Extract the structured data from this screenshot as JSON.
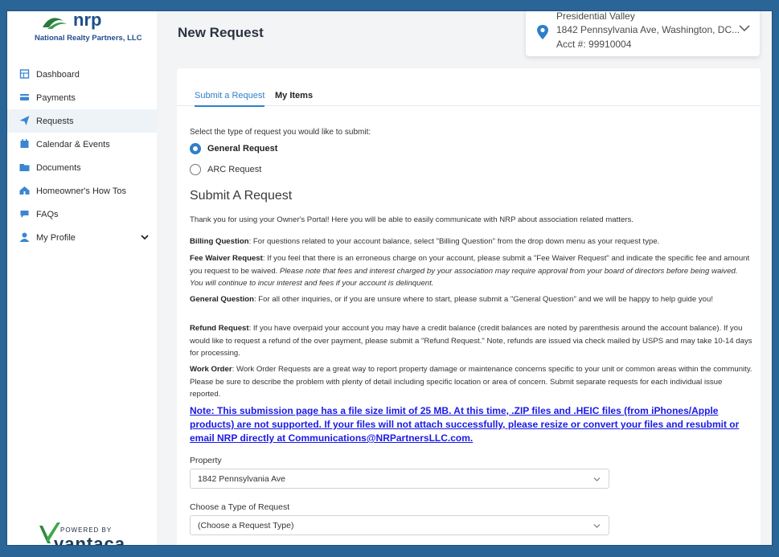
{
  "sidebar": {
    "logo_text": "nrp",
    "company": "National Realty Partners, LLC",
    "items": [
      {
        "label": "Dashboard",
        "icon": "dashboard-icon"
      },
      {
        "label": "Payments",
        "icon": "card-icon"
      },
      {
        "label": "Requests",
        "icon": "send-icon"
      },
      {
        "label": "Calendar & Events",
        "icon": "calendar-icon"
      },
      {
        "label": "Documents",
        "icon": "folder-icon"
      },
      {
        "label": "Homeowner's How Tos",
        "icon": "home-info-icon"
      },
      {
        "label": "FAQs",
        "icon": "faq-icon"
      },
      {
        "label": "My Profile",
        "icon": "user-icon"
      }
    ],
    "powered_by": "POWERED BY",
    "powered_brand": "vantaca"
  },
  "header": {
    "title": "New Request",
    "account": {
      "community": "Presidential Valley",
      "address": "1842 Pennsylvania Ave, Washington, DC...",
      "acct": "Acct #: 99910004"
    }
  },
  "tabs": [
    {
      "label": "Submit a Request",
      "active": true
    },
    {
      "label": "My Items",
      "active": false
    }
  ],
  "form": {
    "select_prompt": "Select the type of request you would like to submit:",
    "radio_general": "General Request",
    "radio_arc": "ARC Request",
    "heading": "Submit A Request",
    "intro": "Thank you for using your Owner's Portal!  Here you will be able to easily communicate with NRP about association related matters.",
    "billing_label": "Billing Question",
    "billing_text": ":  For questions related to your account balance, select \"Billing Question\" from the drop down menu as your request type.",
    "fee_label": "Fee Waiver Request",
    "fee_text": ": If you feel that there is an erroneous charge on  your account, please submit a \"Fee Waiver Request\" and indicate the specific fee and amount you request to be waived.  ",
    "fee_italic": "Please note that fees and interest charged by your association may require approval from your board of directors before being waived.  You will continue to incur interest and fees if your account is delinquent.",
    "general_label": "General Question",
    "general_text": ":  For all other inquiries, or if you are unsure where to start, please submit a \"General Question\" and we will be happy to help guide you!",
    "refund_label": "Refund Request",
    "refund_text": ":  If you have overpaid your account you may have a credit balance (credit balances are noted by parenthesis around the account balance).  If you would like to request a refund of the over payment, please submit a \"Refund Request.\"  Note, refunds are issued via check mailed by USPS and may take 10-14 days for processing.",
    "work_label": "Work Order",
    "work_text": ": Work Order Requests are a great way to report property damage or maintenance concerns specific to your unit or common areas within the community.  Please be sure to describe the problem with plenty of detail including specific location or area of concern.  Submit separate requests for each individual issue reported.",
    "note": "Note: This submission page has a file size limit of 25 MB. At this time, .ZIP files and .HEIC files (from iPhones/Apple products) are not supported. If your files will not attach successfully, please resize or convert your files and resubmit or email NRP directly at Communications@NRPartnersLLC.com.",
    "property_label": "Property",
    "property_value": "1842 Pennsylvania Ave",
    "type_label": "Choose a Type of Request",
    "type_value": "(Choose a Request Type)"
  },
  "colors": {
    "accent": "#2f7fc8",
    "frame": "#2a6597",
    "note_link": "#1a1ae6"
  }
}
